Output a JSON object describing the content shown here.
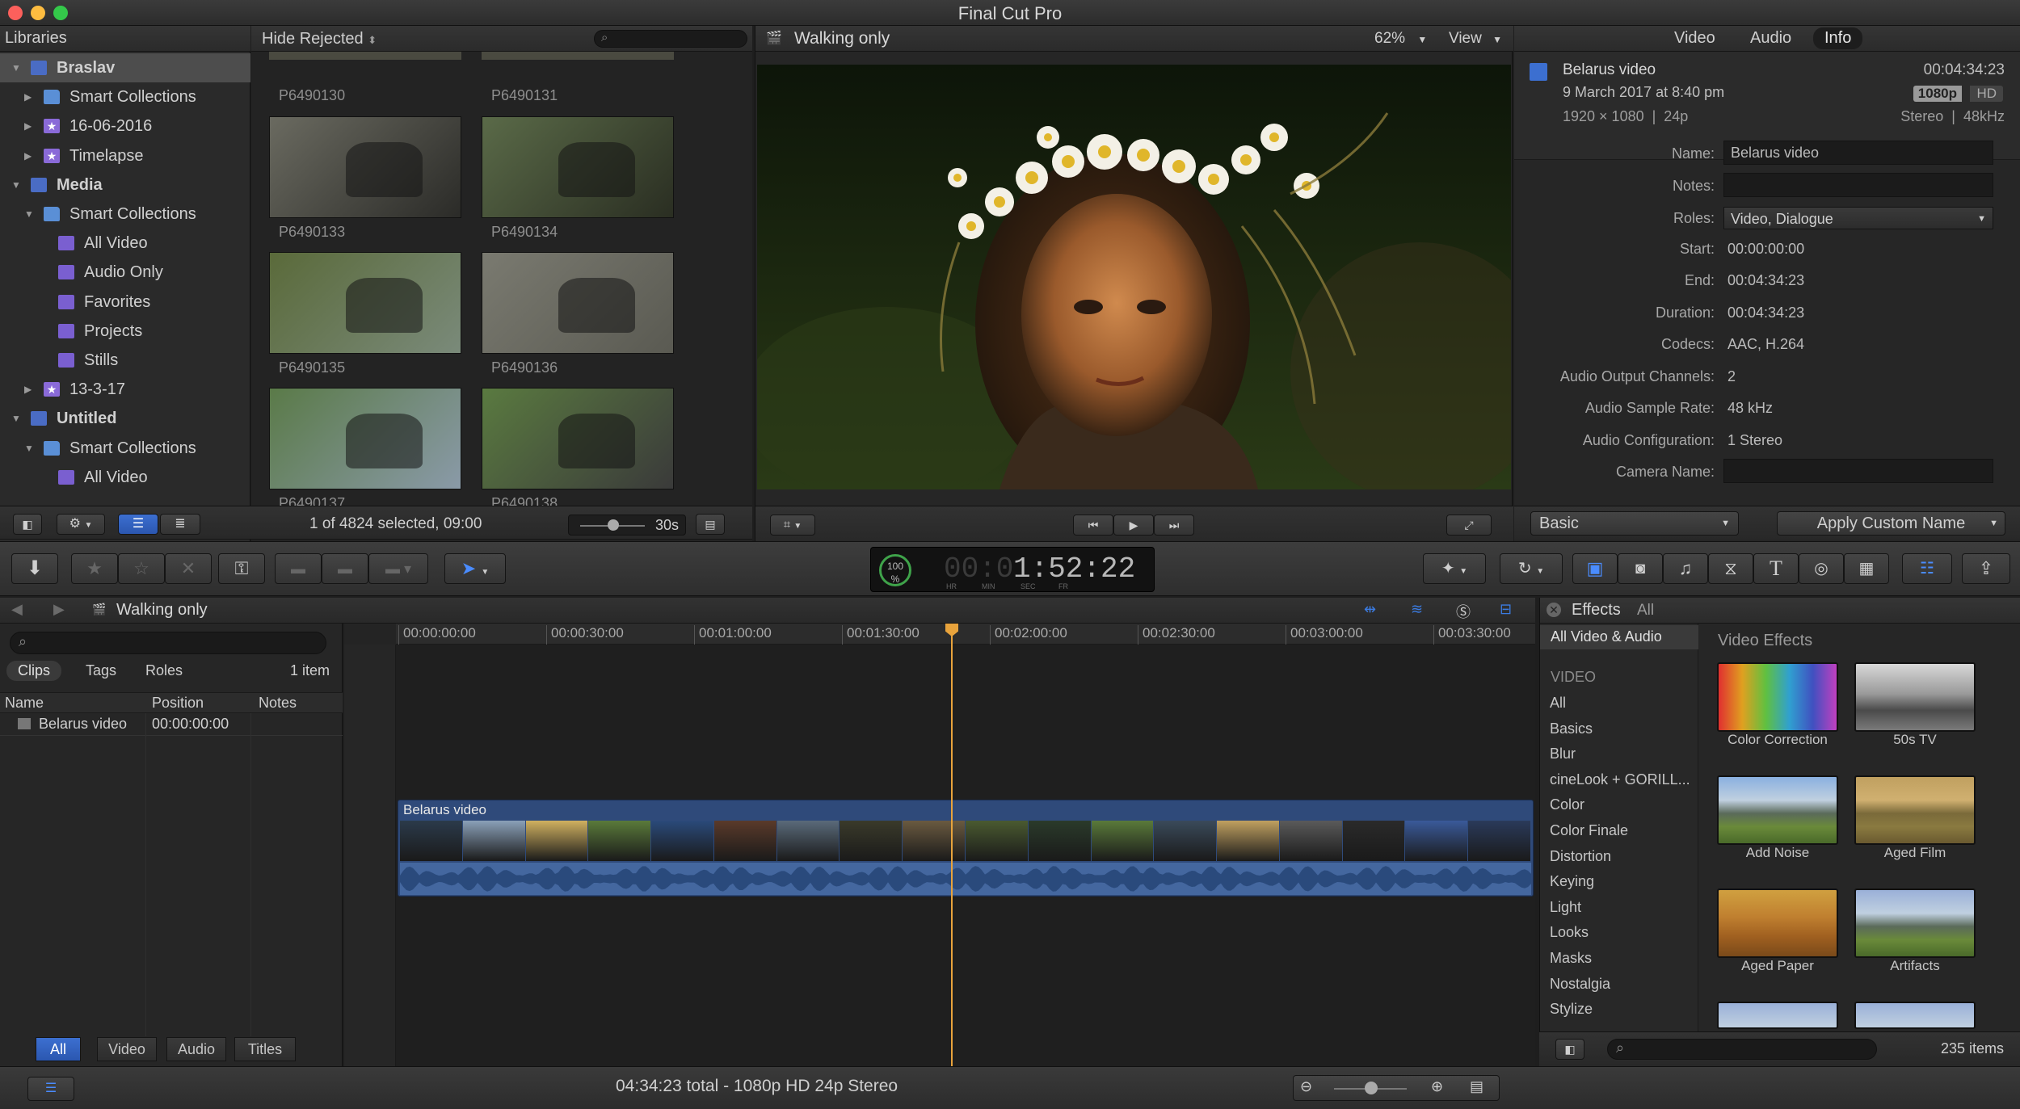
{
  "window": {
    "title": "Final Cut Pro"
  },
  "libraries": {
    "header": "Libraries",
    "items": [
      {
        "label": "Braslav",
        "icon": "library-icon",
        "level": 0,
        "expanded": true,
        "selected": true
      },
      {
        "label": "Smart Collections",
        "icon": "folder-icon",
        "level": 1,
        "expanded": false
      },
      {
        "label": "16-06-2016",
        "icon": "event-icon",
        "level": 1,
        "expanded": false
      },
      {
        "label": "Timelapse",
        "icon": "event-icon",
        "level": 1,
        "expanded": false
      },
      {
        "label": "Media",
        "icon": "library-icon",
        "level": 0,
        "expanded": true
      },
      {
        "label": "Smart Collections",
        "icon": "folder-icon",
        "level": 1,
        "expanded": true
      },
      {
        "label": "All Video",
        "icon": "smart-collection-icon",
        "level": 2
      },
      {
        "label": "Audio Only",
        "icon": "smart-collection-icon",
        "level": 2
      },
      {
        "label": "Favorites",
        "icon": "smart-collection-icon",
        "level": 2
      },
      {
        "label": "Projects",
        "icon": "smart-collection-icon",
        "level": 2
      },
      {
        "label": "Stills",
        "icon": "smart-collection-icon",
        "level": 2
      },
      {
        "label": "13-3-17",
        "icon": "event-icon",
        "level": 1,
        "expanded": false
      },
      {
        "label": "Untitled",
        "icon": "library-icon",
        "level": 0,
        "expanded": true
      },
      {
        "label": "Smart Collections",
        "icon": "folder-icon",
        "level": 1,
        "expanded": true
      },
      {
        "label": "All Video",
        "icon": "smart-collection-icon",
        "level": 2
      }
    ]
  },
  "browser": {
    "filter": "Hide Rejected",
    "top_labels": [
      "P6490130",
      "P6490131"
    ],
    "clips": [
      "P6490133",
      "P6490134",
      "P6490135",
      "P6490136",
      "P6490137",
      "P6490138"
    ],
    "status": "1 of 4824 selected, 09:00",
    "zoom": "30s"
  },
  "viewer": {
    "title": "Walking only",
    "zoom": "62%",
    "view_menu": "View"
  },
  "inspector": {
    "tabs": [
      "Video",
      "Audio",
      "Info"
    ],
    "active_tab": "Info",
    "clip_name": "Belarus video",
    "duration": "00:04:34:23",
    "date": "9 March 2017 at 8:40 pm",
    "badge_res": "1080p",
    "badge_hd": "HD",
    "format": "1920 × 1080  |  24p",
    "audio_format": "Stereo  |  48kHz",
    "fields": {
      "name": {
        "label": "Name:",
        "value": "Belarus video"
      },
      "notes": {
        "label": "Notes:",
        "value": ""
      },
      "roles": {
        "label": "Roles:",
        "value": "Video, Dialogue"
      },
      "start": {
        "label": "Start:",
        "value": "00:00:00:00"
      },
      "end": {
        "label": "End:",
        "value": "00:04:34:23"
      },
      "duration": {
        "label": "Duration:",
        "value": "00:04:34:23"
      },
      "codecs": {
        "label": "Codecs:",
        "value": "AAC, H.264"
      },
      "channels": {
        "label": "Audio Output Channels:",
        "value": "2"
      },
      "samplerate": {
        "label": "Audio Sample Rate:",
        "value": "48 kHz"
      },
      "config": {
        "label": "Audio Configuration:",
        "value": "1 Stereo"
      },
      "camera": {
        "label": "Camera Name:",
        "value": ""
      }
    },
    "metadata_view": "Basic",
    "apply_name": "Apply Custom Name"
  },
  "toolbar": {
    "timecode": "1:52:22",
    "timecode_dim": "00:0",
    "timecode_units": [
      "HR",
      "MIN",
      "SEC",
      "FR"
    ],
    "progress_label": "100 %"
  },
  "timeline_index": {
    "project": "Walking only",
    "tabs": [
      "Clips",
      "Tags",
      "Roles"
    ],
    "count": "1 item",
    "columns": [
      "Name",
      "Position",
      "Notes"
    ],
    "rows": [
      {
        "name": "Belarus video",
        "position": "00:00:00:00",
        "notes": ""
      }
    ],
    "bottom_tabs": [
      "All",
      "Video",
      "Audio",
      "Titles"
    ]
  },
  "timeline": {
    "ruler": [
      "00:00:00:00",
      "00:00:30:00",
      "00:01:00:00",
      "00:01:30:00",
      "00:02:00:00",
      "00:02:30:00",
      "00:03:00:00",
      "00:03:30:00"
    ],
    "clip_name": "Belarus video",
    "status": "04:34:23 total - 1080p HD 24p Stereo"
  },
  "effects": {
    "title": "Effects",
    "filter": "All",
    "source": "All Video & Audio",
    "section": "VIDEO",
    "categories": [
      "All",
      "Basics",
      "Blur",
      "cineLook + GORILL...",
      "Color",
      "Color Finale",
      "Distortion",
      "Keying",
      "Light",
      "Looks",
      "Masks",
      "Nostalgia",
      "Stylize"
    ],
    "grid_title": "Video Effects",
    "items": [
      "Color Correction",
      "50s TV",
      "Add Noise",
      "Aged Film",
      "Aged Paper",
      "Artifacts"
    ],
    "count": "235 items"
  },
  "colors": {
    "accent": "#3b7be0",
    "playhead": "#e8a33c",
    "clip": "#3f5a86",
    "selection": "#5a7fc8"
  }
}
